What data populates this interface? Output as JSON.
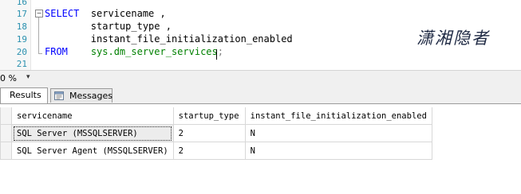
{
  "editor": {
    "line_numbers": [
      "16",
      "17",
      "18",
      "19",
      "20",
      "21"
    ],
    "lines": [
      {
        "keyword": "SELECT",
        "text": "servicename ,"
      },
      {
        "keyword": "",
        "text": "startup_type ,"
      },
      {
        "keyword": "",
        "text": "instant_file_initialization_enabled"
      },
      {
        "keyword": "FROM",
        "system": "sys.dm_server_services",
        "punct": ";"
      }
    ],
    "fold_symbol": "−",
    "watermark": "潇湘隐者"
  },
  "statusbar": {
    "zoom": "0 %",
    "zoom_arrow": "▾"
  },
  "tabs": [
    {
      "label": "Results"
    },
    {
      "label": "Messages"
    }
  ],
  "grid": {
    "columns": [
      "servicename",
      "startup_type",
      "instant_file_initialization_enabled"
    ],
    "rows": [
      [
        "SQL Server (MSSQLSERVER)",
        "2",
        "N"
      ],
      [
        "SQL Server Agent (MSSQLSERVER)",
        "2",
        "N"
      ]
    ]
  },
  "colors": {
    "keyword": "#0000ff",
    "system_object": "#008000",
    "line_number": "#2b91af"
  }
}
